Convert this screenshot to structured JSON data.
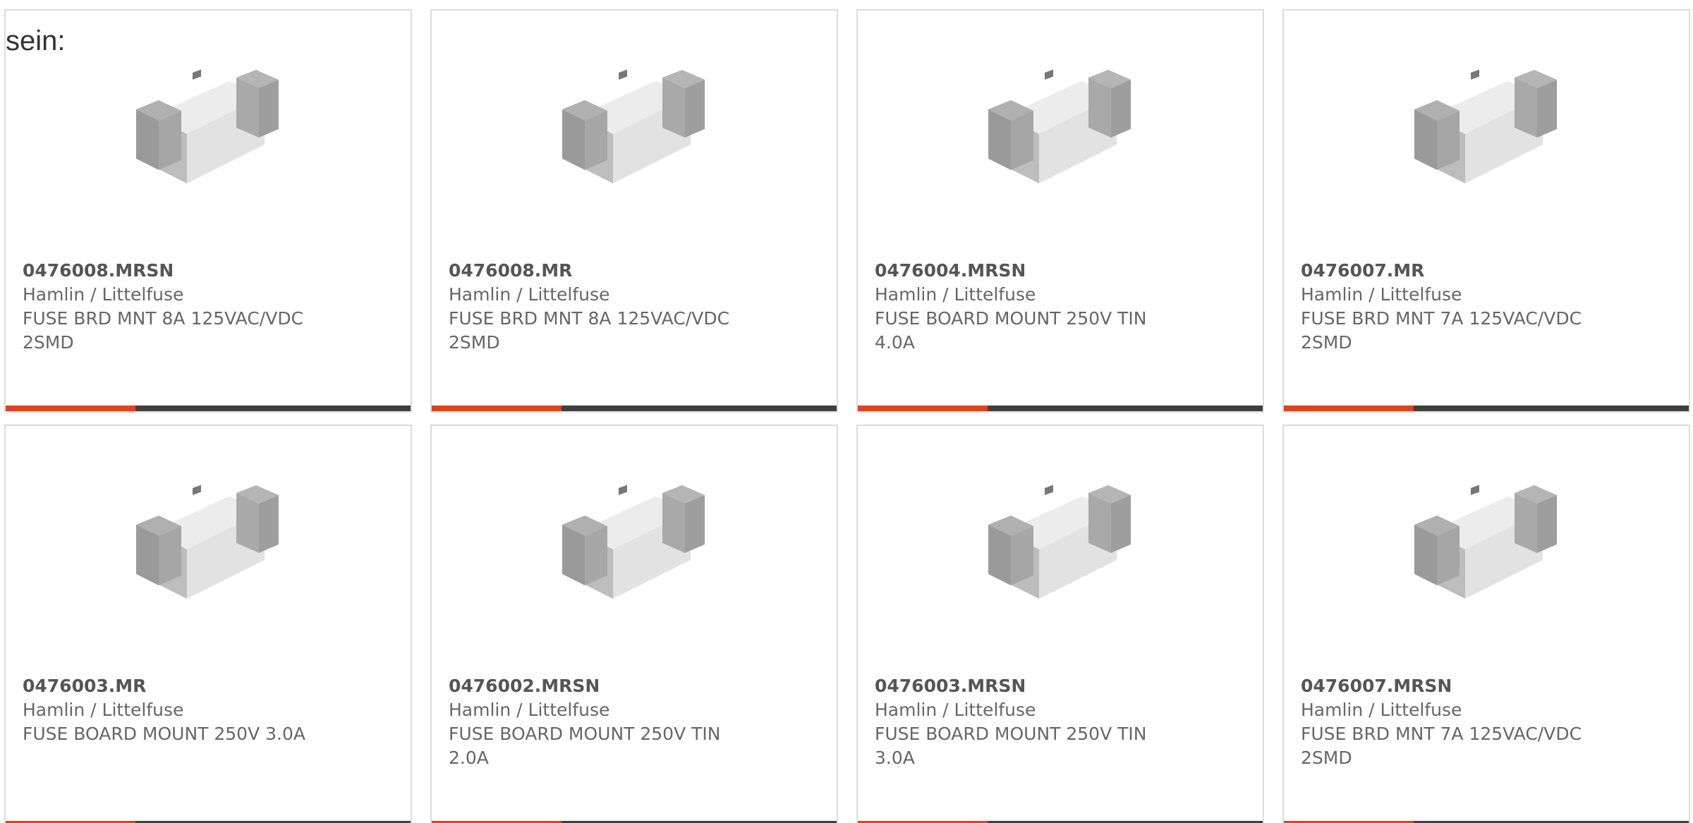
{
  "intro_text": "sein:",
  "products": [
    {
      "part_number": "0476008.MRSN",
      "manufacturer": "Hamlin / Littelfuse",
      "description_line1": "FUSE BRD MNT 8A 125VAC/VDC",
      "description_line2": "2SMD"
    },
    {
      "part_number": "0476008.MR",
      "manufacturer": "Hamlin / Littelfuse",
      "description_line1": "FUSE BRD MNT 8A 125VAC/VDC",
      "description_line2": "2SMD"
    },
    {
      "part_number": "0476004.MRSN",
      "manufacturer": "Hamlin / Littelfuse",
      "description_line1": "FUSE BOARD MOUNT 250V TIN",
      "description_line2": "4.0A"
    },
    {
      "part_number": "0476007.MR",
      "manufacturer": "Hamlin / Littelfuse",
      "description_line1": "FUSE BRD MNT 7A 125VAC/VDC",
      "description_line2": "2SMD"
    },
    {
      "part_number": "0476003.MR",
      "manufacturer": "Hamlin / Littelfuse",
      "description_line1": "FUSE BOARD MOUNT 250V 3.0A",
      "description_line2": ""
    },
    {
      "part_number": "0476002.MRSN",
      "manufacturer": "Hamlin / Littelfuse",
      "description_line1": "FUSE BOARD MOUNT 250V TIN",
      "description_line2": "2.0A"
    },
    {
      "part_number": "0476003.MRSN",
      "manufacturer": "Hamlin / Littelfuse",
      "description_line1": "FUSE BOARD MOUNT 250V TIN",
      "description_line2": "3.0A"
    },
    {
      "part_number": "0476007.MRSN",
      "manufacturer": "Hamlin / Littelfuse",
      "description_line1": "FUSE BRD MNT 7A 125VAC/VDC",
      "description_line2": "2SMD"
    }
  ],
  "colors": {
    "accent": "#e0421b",
    "bar": "#3f3f3f",
    "border": "#dcdcdc",
    "text": "#666666"
  },
  "icons": {
    "product_image": "smd-fuse-icon"
  }
}
